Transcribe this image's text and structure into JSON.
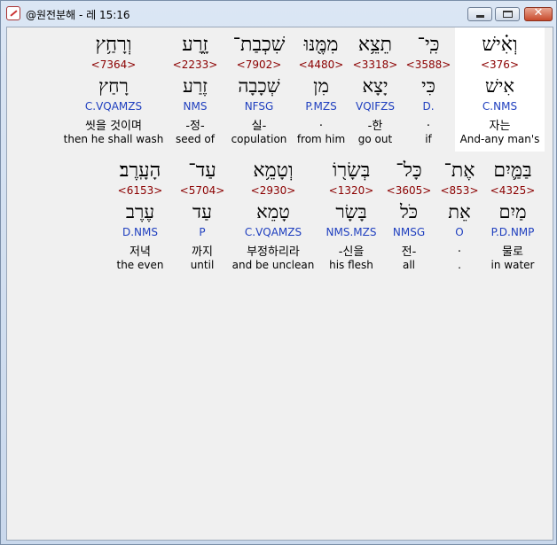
{
  "window": {
    "title": "@원전분해 - 레 15:16"
  },
  "rows": [
    [
      {
        "heb": "וְאִ֗ישׁ",
        "num": "<376>",
        "lemma": "אִישׁ",
        "code": "C.NMS",
        "kor": "자는",
        "eng": "And-any man's"
      },
      {
        "heb": "כִּֽי־",
        "num": "<3588>",
        "lemma": "כִּי",
        "code": "D.",
        "kor": ".",
        "eng": "if"
      },
      {
        "heb": "תֵצֵ֥א",
        "num": "<3318>",
        "lemma": "יָצָא",
        "code": "VQIFZS",
        "kor": "-한",
        "eng": "go out"
      },
      {
        "heb": "מִמֶּ֖נּוּ",
        "num": "<4480>",
        "lemma": "מִן",
        "code": "P.MZS",
        "kor": ".",
        "eng": "from him"
      },
      {
        "heb": "שִׁכְבַת־",
        "num": "<7902>",
        "lemma": "שְׁכָבָה",
        "code": "NFSG",
        "kor": "실-",
        "eng": "copulation"
      },
      {
        "heb": "זָ֑רַע",
        "num": "<2233>",
        "lemma": "זֶרַע",
        "code": "NMS",
        "kor": "-정-",
        "eng": "seed of"
      },
      {
        "heb": "וְרָחַ֥ץ",
        "num": "<7364>",
        "lemma": "רָחַץ",
        "code": "C.VQAMZS",
        "kor": "씻을 것이며",
        "eng": "then he shall wash"
      }
    ],
    [
      {
        "heb": "בַּמַּ֛יִם",
        "num": "<4325>",
        "lemma": "מַיִם",
        "code": "P.D.NMP",
        "kor": "물로",
        "eng": "in water"
      },
      {
        "heb": "אֶת־",
        "num": "<853>",
        "lemma": "אֵת",
        "code": "O",
        "kor": ".",
        "eng": "."
      },
      {
        "heb": "כָּל־",
        "num": "<3605>",
        "lemma": "כֹּל",
        "code": "NMSG",
        "kor": "전-",
        "eng": "all"
      },
      {
        "heb": "בְּשָׂר֖וֹ",
        "num": "<1320>",
        "lemma": "בָּשָׂר",
        "code": "NMS.MZS",
        "kor": "-신을",
        "eng": "his flesh"
      },
      {
        "heb": "וְטָמֵ֥א",
        "num": "<2930>",
        "lemma": "טָמֵא",
        "code": "C.VQAMZS",
        "kor": "부정하리라",
        "eng": "and be unclean"
      },
      {
        "heb": "עַד־",
        "num": "<5704>",
        "lemma": "עַד",
        "code": "P",
        "kor": "까지",
        "eng": "until"
      },
      {
        "heb": "הָעָֽרֶב׃",
        "num": "<6153>",
        "lemma": "עֶרֶב",
        "code": "D.NMS",
        "kor": "저녁",
        "eng": "the even"
      }
    ]
  ]
}
